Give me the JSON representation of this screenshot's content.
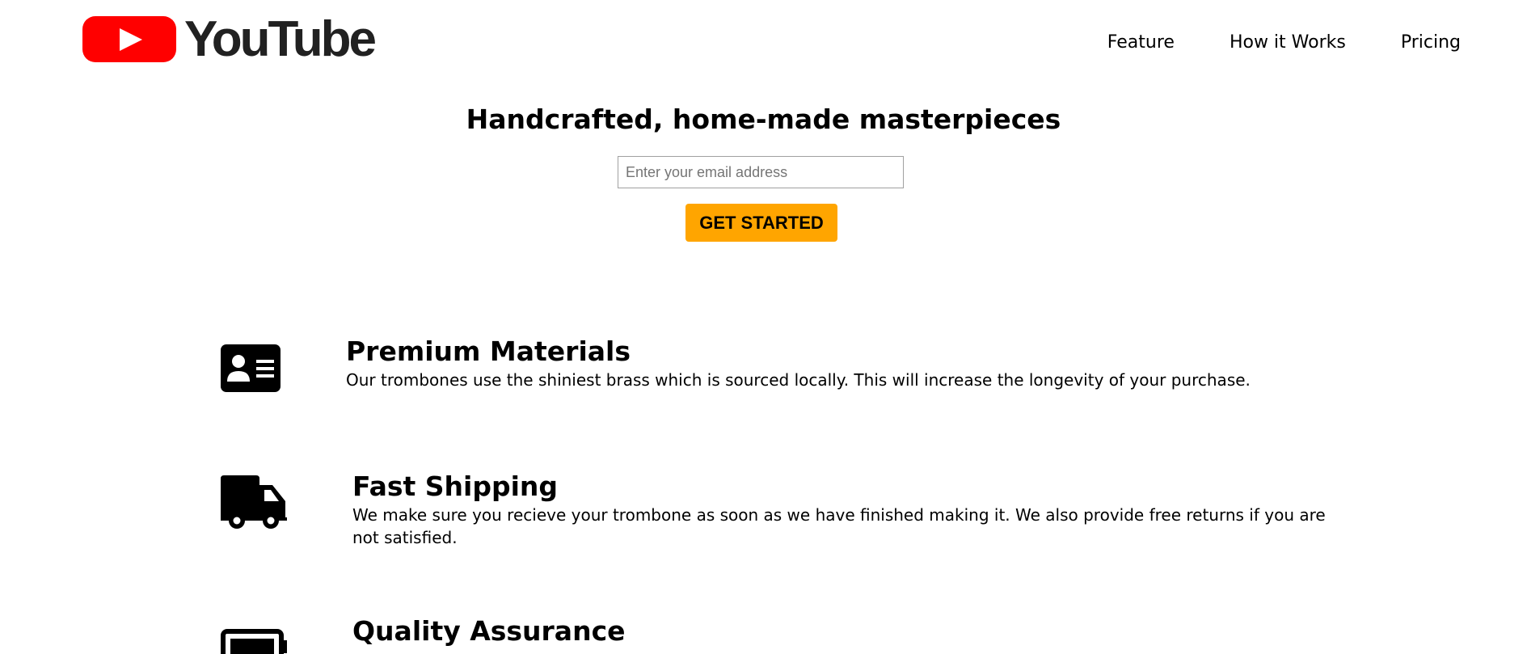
{
  "header": {
    "logo_text": "YouTube",
    "nav": [
      {
        "label": "Feature"
      },
      {
        "label": "How it Works"
      },
      {
        "label": "Pricing"
      }
    ]
  },
  "hero": {
    "title": "Handcrafted, home-made masterpieces",
    "email_placeholder": "Enter your email address",
    "cta_label": "GET STARTED"
  },
  "features": [
    {
      "icon": "id-card-icon",
      "title": "Premium Materials",
      "text": "Our trombones use the shiniest brass which is sourced locally. This will increase the longevity of your purchase."
    },
    {
      "icon": "truck-icon",
      "title": "Fast Shipping",
      "text": "We make sure you recieve your trombone as soon as we have finished making it. We also provide free returns if you are not satisfied."
    },
    {
      "icon": "battery-icon",
      "title": "Quality Assurance",
      "text": ""
    }
  ],
  "colors": {
    "logo_red": "#ff0000",
    "cta_orange": "#ffa500"
  }
}
